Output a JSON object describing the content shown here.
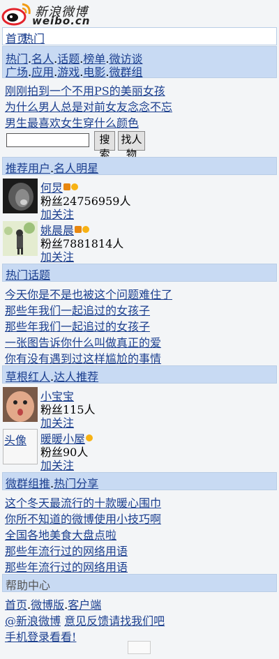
{
  "logo": {
    "name": "新浪微博",
    "domain": "weibo.cn"
  },
  "top_nav": [
    "首页",
    "热门"
  ],
  "grid_rows": [
    [
      "热门",
      "名人",
      "话题",
      "榜单",
      "微访谈"
    ],
    [
      "广场",
      "应用",
      "游戏",
      "电影",
      "微群组"
    ]
  ],
  "promo_links": [
    "刚刚拍到一个不用PS的美丽女孩",
    "为什么男人总是对前女友念念不忘",
    "男生最喜欢女生穿什么颜色"
  ],
  "search": {
    "placeholder": "",
    "search_label": "搜索",
    "find_user_label": "找人物"
  },
  "sections": {
    "hot_users": {
      "title1": "推荐用户",
      "title2": "名人明星"
    },
    "hot_topics": {
      "title": "热门话题"
    },
    "grassroots": {
      "title1": "草根红人",
      "title2": "达人推荐"
    },
    "more": {
      "title1": "微群组推",
      "title2": "热门分享"
    },
    "help": {
      "title": "帮助中心"
    }
  },
  "users_top": [
    {
      "name": "何炅",
      "fans": "粉丝24756959人",
      "follow": "加关注",
      "avatar_color": "#333"
    },
    {
      "name": "姚晨晨",
      "fans": "粉丝7881814人",
      "follow": "加关注",
      "avatar_color": "#a9c48c"
    }
  ],
  "hot_topics": [
    "今天你是不是也被这个问题难住了",
    "那些年我们一起追过的女孩子",
    "那些年我们一起追过的女孩子",
    "一张图告诉你什么叫做真正的爱",
    "你有没有遇到过这样尴尬的事情"
  ],
  "users_bottom": [
    {
      "name": "小宝宝",
      "fans": "粉丝115人",
      "follow": "加关注",
      "avatar_color": "#c98a6a"
    },
    {
      "name": "暖暖小屋",
      "fans": "粉丝90人",
      "follow": "加关注",
      "avatar_label": "头像"
    }
  ],
  "more_links": [
    "这个冬天最流行的十款暖心围巾",
    "你所不知道的微博使用小技巧啊",
    "全国各地美食大盘点啦",
    "那些年流行过的网络用语"
  ],
  "footer": {
    "row1": [
      "首页",
      "微博版",
      "客户端"
    ],
    "row2_prefix": "@新浪微博",
    "row2_suffix": "意见反馈请找我们吧",
    "row3": "手机登录看看!"
  }
}
